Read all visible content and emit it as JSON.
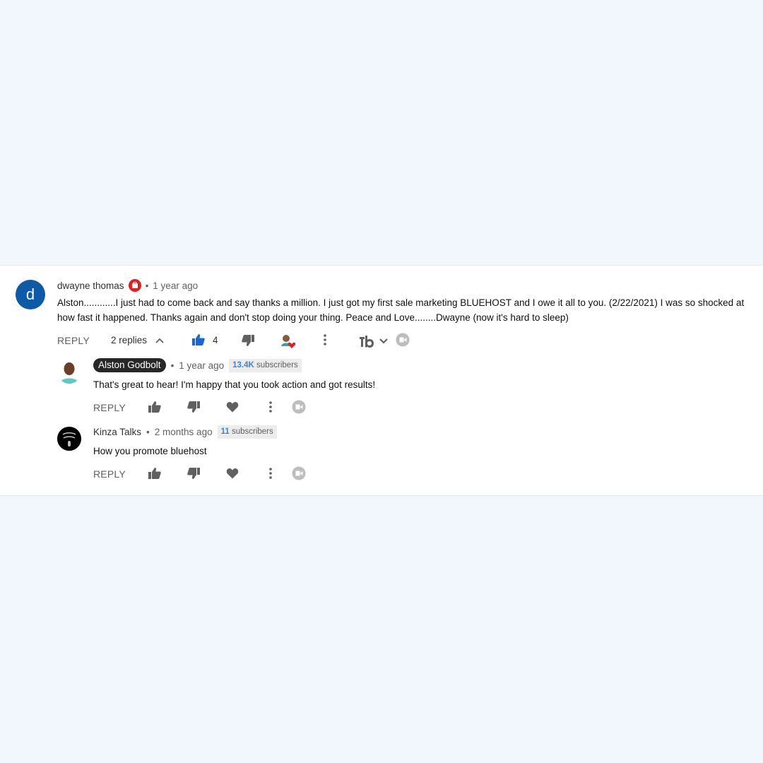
{
  "comment": {
    "author": "dwayne thomas",
    "avatar_letter": "d",
    "avatar_color": "#0d5aa7",
    "time": "1 year ago",
    "text_line1": "Alston............I just had to come back and say thanks a million.  I just got my first sale marketing BLUEHOST and I owe it all to you.  (2/22/2021)  I was so shocked at",
    "text_line2": "how fast it happened.  Thanks again and don't stop doing your thing.  Peace and Love........Dwayne  (now it's hard to sleep)",
    "reply_label": "REPLY",
    "replies_label": "2 replies",
    "like_count": "4",
    "like_color": "#1a66d4"
  },
  "replies": [
    {
      "author": "Alston Godbolt",
      "time": "1 year ago",
      "subscribers_count": "13.4K",
      "subscribers_label": "subscribers",
      "text": "That's great to hear! I'm happy that you took action and got results!",
      "reply_label": "REPLY"
    },
    {
      "author": "Kinza Talks",
      "time": "2 months ago",
      "subscribers_count": "11",
      "subscribers_label": "subscribers",
      "text": "How you promote bluehost",
      "reply_label": "REPLY"
    }
  ],
  "separator": "•",
  "colors": {
    "background": "#f1f7fd",
    "badge_count": "#3d84d9",
    "heart": "#e02020"
  }
}
